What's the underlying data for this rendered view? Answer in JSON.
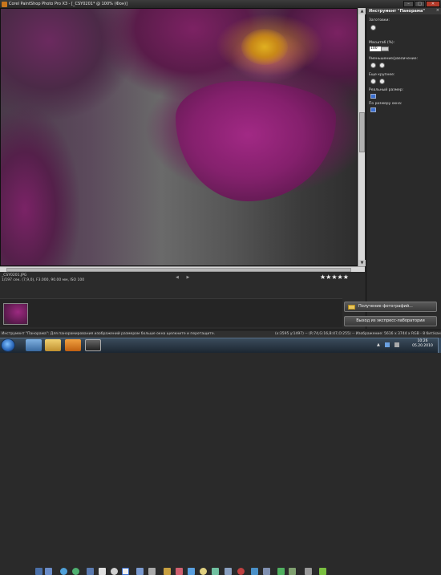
{
  "window": {
    "title": "Corel PaintShop Photo Pro X3 - [_CSY0201* @ 100% (Фон)]",
    "buttons": {
      "minimize": "–",
      "maximize": "□",
      "close": "✕"
    }
  },
  "palette": {
    "title": "Инструмент \"Панорама\"",
    "close": "×",
    "presets_label": "Заготовки:",
    "zoom_label": "Масштаб (%):",
    "zoom_value": "100",
    "zoom_in_out_label": "Уменьшение/увеличение:",
    "zoom_more_label": "Еще крупнее:",
    "actual_size_label": "Реальный размер:",
    "fit_window_label": "По размеру окна:"
  },
  "info": {
    "filename": "_CSY0201.JPG",
    "exif": "1/197 сек. (7,9,0), F3.000, 90.00 мм, ISO 100"
  },
  "nav": {
    "prev": "◀",
    "next": "▶"
  },
  "rating": {
    "stars": "★★★★★",
    "value": 5
  },
  "buttons": {
    "get_photos": "Получение фотографий...",
    "exit_express": "Выход из экспресс-лаборатории"
  },
  "status": {
    "left": "Инструмент \"Панорама\": Для панорамирования изображений размером больше окна щелкните и перетащите.",
    "right": "(x:3595 y:1497) -- (R:74,G:16,B:47,O:255) -- Изображение: 5616 x 3744 x RGB - 8 бит/канал"
  },
  "taskbar": {
    "time": "10:26",
    "date": "05.20.2010"
  },
  "colors": {
    "accent": "#3b6fd0",
    "flower": "#86206e",
    "stamen": "#d9a520"
  }
}
